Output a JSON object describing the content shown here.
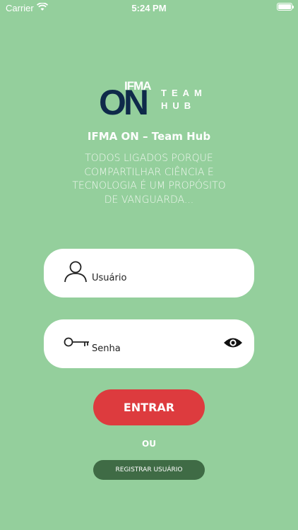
{
  "status_bar": {
    "carrier": "Carrier",
    "time": "5:24 PM"
  },
  "logo": {
    "ifma": "IFMA",
    "on": "ON",
    "team": "TEAM",
    "hub": "HUB"
  },
  "app_title": "IFMA ON – Team Hub",
  "tagline": "TODOS LIGADOS PORQUE COMPARTILHAR CIÊNCIA E TECNOLOGIA É UM PROPÓSITO DE VANGUARDA...",
  "login": {
    "username_placeholder": "Usuário",
    "password_placeholder": "Senha",
    "enter_label": "ENTRAR",
    "or_label": "OU",
    "register_label": "REGISTRAR USUÁRIO"
  },
  "colors": {
    "background": "#94cf9c",
    "enter_button": "#dd3b3e",
    "register_button": "#3f6b45",
    "logo_dark": "#0f2a4a"
  },
  "icons": {
    "username": "user-icon",
    "password": "key-icon",
    "toggle_visibility": "eye-icon"
  }
}
